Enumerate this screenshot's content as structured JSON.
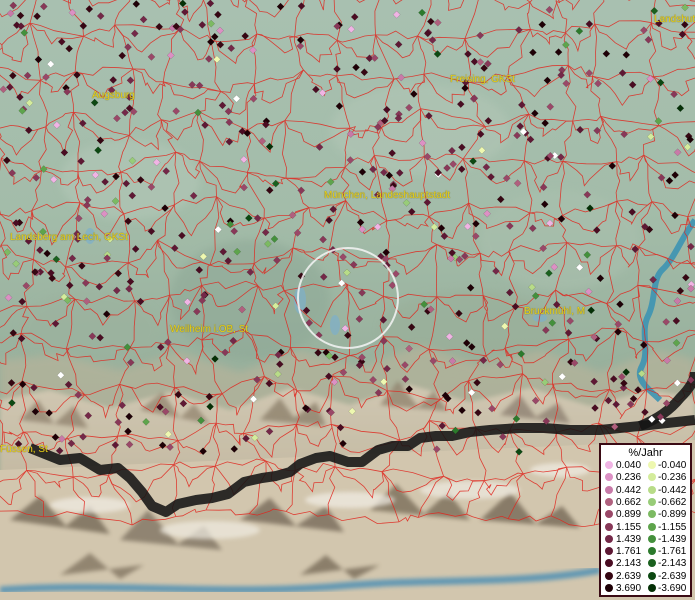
{
  "map": {
    "places": [
      {
        "name": "Landshut"
      },
      {
        "name": "Augsburg"
      },
      {
        "name": "Freising, GKSt"
      },
      {
        "name": "München, Landeshauptstadt"
      },
      {
        "name": "Landsberg am Lech, GKSt"
      },
      {
        "name": "Weilheim i.OB, St"
      },
      {
        "name": "Bruckmühl, M"
      },
      {
        "name": "Füssen, St"
      }
    ]
  },
  "legend": {
    "title": "%/Jahr",
    "positive": [
      {
        "value": "0.040",
        "color": "#f0b4e4"
      },
      {
        "value": "0.236",
        "color": "#dc90c4"
      },
      {
        "value": "0.442",
        "color": "#c87aa8"
      },
      {
        "value": "0.662",
        "color": "#b0607e"
      },
      {
        "value": "0.899",
        "color": "#9a4868"
      },
      {
        "value": "1.155",
        "color": "#883858"
      },
      {
        "value": "1.439",
        "color": "#742848"
      },
      {
        "value": "1.761",
        "color": "#5e1834"
      },
      {
        "value": "2.143",
        "color": "#4a0c22"
      },
      {
        "value": "2.639",
        "color": "#360612"
      },
      {
        "value": "3.690",
        "color": "#1e0006"
      }
    ],
    "negative": [
      {
        "value": "-0.040",
        "color": "#eef8b0"
      },
      {
        "value": "-0.236",
        "color": "#d4ec9c"
      },
      {
        "value": "-0.442",
        "color": "#b8dc88"
      },
      {
        "value": "-0.662",
        "color": "#98cc78"
      },
      {
        "value": "-0.899",
        "color": "#7cba62"
      },
      {
        "value": "-1.155",
        "color": "#5ea44c"
      },
      {
        "value": "-1.439",
        "color": "#44903c"
      },
      {
        "value": "-1.761",
        "color": "#2c7a2c"
      },
      {
        "value": "-2.143",
        "color": "#1a601e"
      },
      {
        "value": "-2.639",
        "color": "#0c4812"
      },
      {
        "value": "-3.690",
        "color": "#043006"
      }
    ]
  }
}
